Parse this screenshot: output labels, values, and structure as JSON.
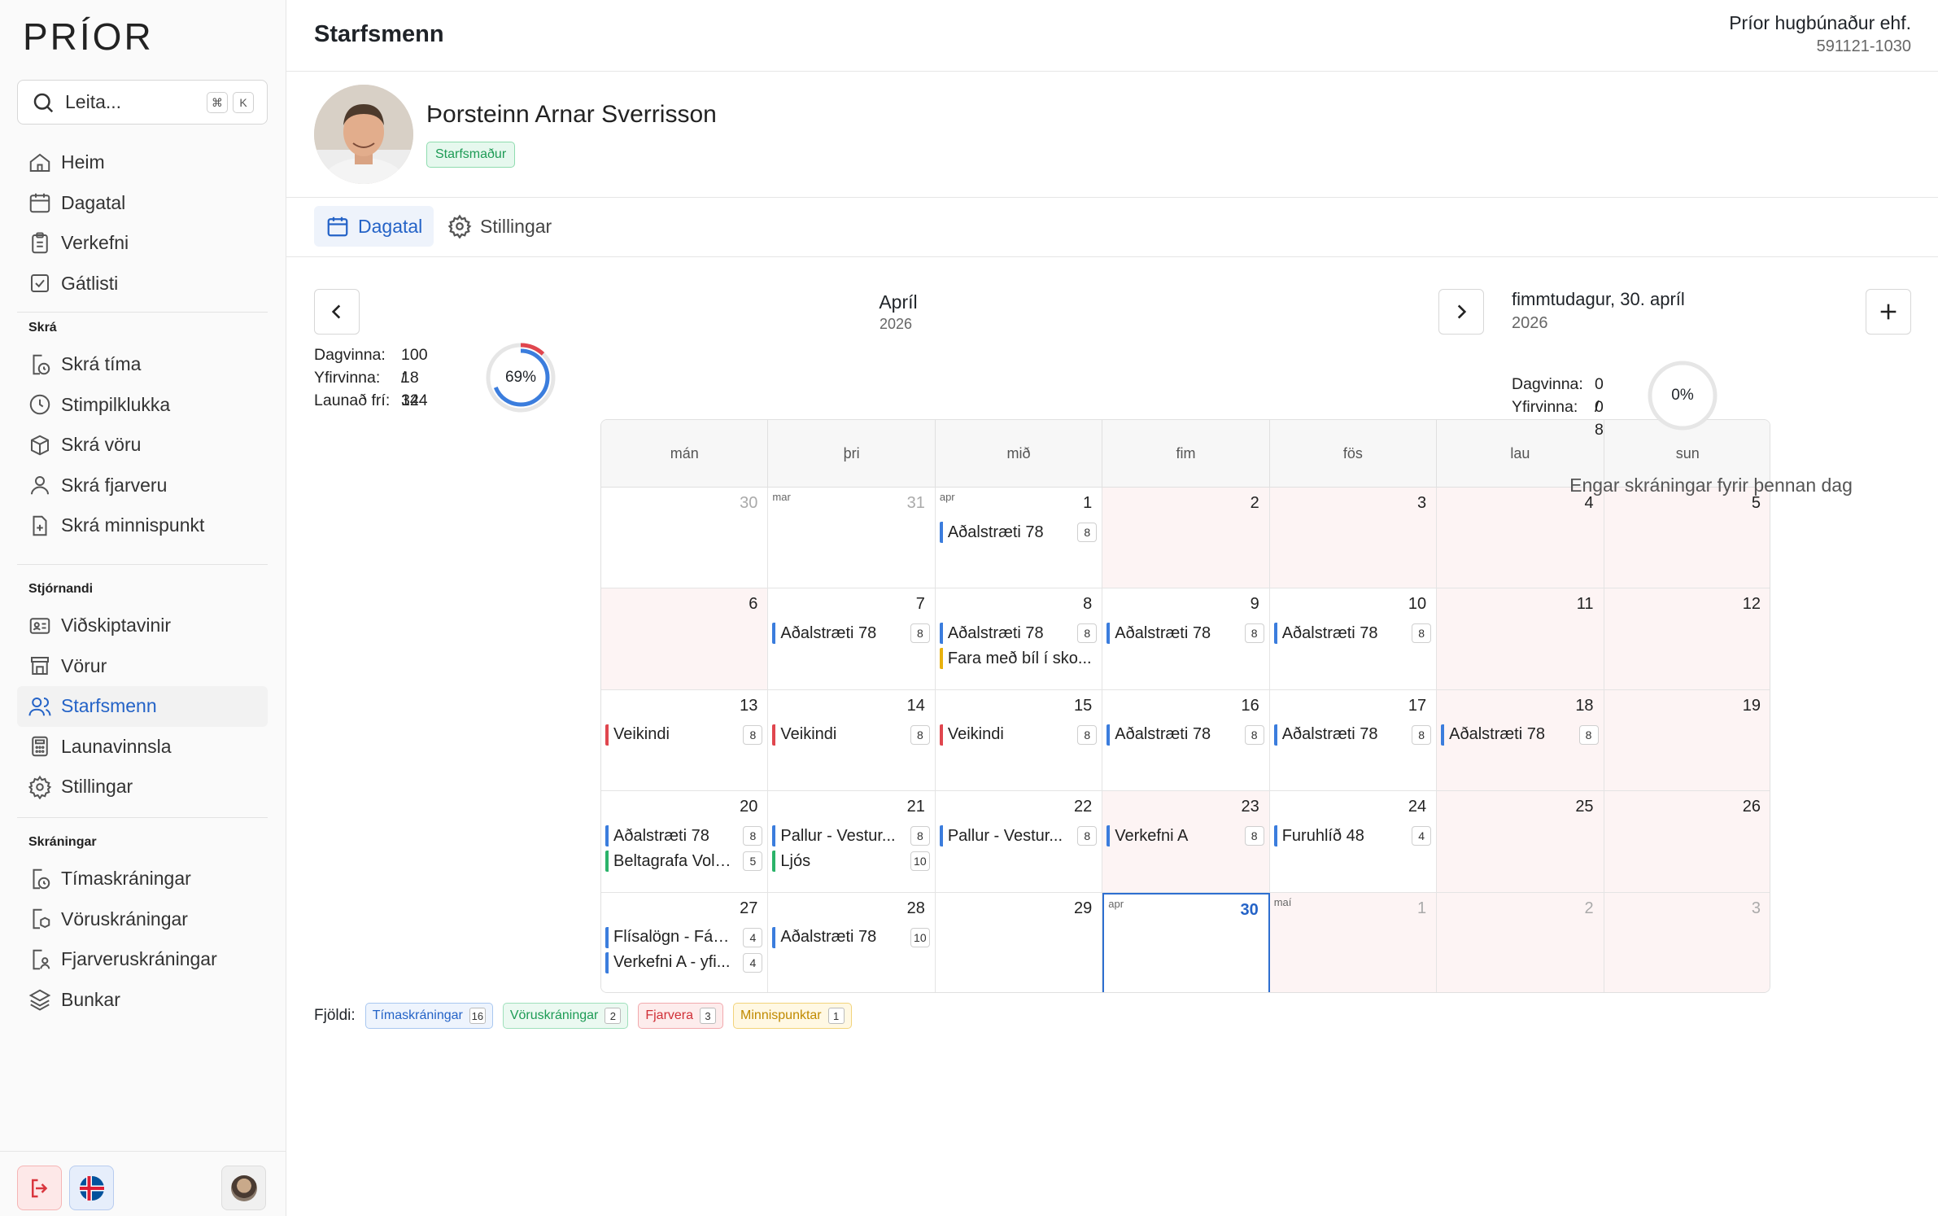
{
  "sidebar": {
    "logo": "PRÍOR",
    "search": {
      "label": "Leita...",
      "k1": "⌘",
      "k2": "K"
    },
    "main_items": [
      {
        "label": "Heim",
        "icon": "home-icon"
      },
      {
        "label": "Dagatal",
        "icon": "calendar-icon"
      },
      {
        "label": "Verkefni",
        "icon": "clipboard-icon"
      },
      {
        "label": "Gátlisti",
        "icon": "checkbox-icon"
      }
    ],
    "skra_title": "Skrá",
    "skra_items": [
      {
        "label": "Skrá tíma",
        "icon": "timer-doc-icon"
      },
      {
        "label": "Stimpilklukka",
        "icon": "clock-icon"
      },
      {
        "label": "Skrá vöru",
        "icon": "package-icon"
      },
      {
        "label": "Skrá fjarveru",
        "icon": "user-icon"
      },
      {
        "label": "Skrá minnispunkt",
        "icon": "note-plus-icon"
      }
    ],
    "admin_title": "Stjórnandi",
    "admin_items": [
      {
        "label": "Viðskiptavinir",
        "icon": "contact-card-icon"
      },
      {
        "label": "Vörur",
        "icon": "store-icon"
      },
      {
        "label": "Starfsmenn",
        "icon": "users-icon",
        "active": true
      },
      {
        "label": "Launavinnsla",
        "icon": "calculator-icon"
      },
      {
        "label": "Stillingar",
        "icon": "gear-icon"
      }
    ],
    "reg_title": "Skráningar",
    "reg_items": [
      {
        "label": "Tímaskráningar",
        "icon": "timer-doc-icon"
      },
      {
        "label": "Vöruskráningar",
        "icon": "package-doc-icon"
      },
      {
        "label": "Fjarveruskráningar",
        "icon": "user-doc-icon"
      },
      {
        "label": "Bunkar",
        "icon": "layers-icon"
      }
    ]
  },
  "header": {
    "title": "Starfsmenn",
    "company": "Príor hugbúnaður ehf.",
    "kennitala": "591121-1030"
  },
  "employee": {
    "name": "Þorsteinn Arnar Sverrisson",
    "role": "Starfsmaður"
  },
  "tabs": [
    {
      "label": "Dagatal",
      "icon": "calendar-icon"
    },
    {
      "label": "Stillingar",
      "icon": "gear-icon"
    }
  ],
  "calendar": {
    "month": "Apríl",
    "year": "2026",
    "stats": {
      "dagvinna_label": "Dagvinna:",
      "dagvinna": "100 / 144",
      "yfirvinna_label": "Yfirvinna:",
      "yfirvinna": "18",
      "launad_label": "Launað frí:",
      "launad": "32",
      "percent": "69%",
      "fraction": 0.69
    },
    "weekdays": [
      "mán",
      "þri",
      "mið",
      "fim",
      "fös",
      "lau",
      "sun"
    ],
    "weeks": [
      [
        {
          "d": "30",
          "dim": true
        },
        {
          "d": "31",
          "dim": true,
          "m": "mar"
        },
        {
          "d": "1",
          "m": "apr",
          "ev": [
            {
              "t": "Aðalstræti 78",
              "n": "8",
              "c": "blue"
            }
          ]
        },
        {
          "d": "2",
          "we": true
        },
        {
          "d": "3",
          "we": true
        },
        {
          "d": "4",
          "we": true
        },
        {
          "d": "5",
          "we": true
        }
      ],
      [
        {
          "d": "6",
          "we": true
        },
        {
          "d": "7",
          "ev": [
            {
              "t": "Aðalstræti 78",
              "n": "8",
              "c": "blue"
            }
          ]
        },
        {
          "d": "8",
          "ev": [
            {
              "t": "Aðalstræti 78",
              "n": "8",
              "c": "blue"
            },
            {
              "t": "Fara með bíl í sko...",
              "n": "",
              "c": "yellow"
            }
          ]
        },
        {
          "d": "9",
          "ev": [
            {
              "t": "Aðalstræti 78",
              "n": "8",
              "c": "blue"
            }
          ]
        },
        {
          "d": "10",
          "ev": [
            {
              "t": "Aðalstræti 78",
              "n": "8",
              "c": "blue"
            }
          ]
        },
        {
          "d": "11",
          "we": true
        },
        {
          "d": "12",
          "we": true
        }
      ],
      [
        {
          "d": "13",
          "ev": [
            {
              "t": "Veikindi",
              "n": "8",
              "c": "red"
            }
          ]
        },
        {
          "d": "14",
          "ev": [
            {
              "t": "Veikindi",
              "n": "8",
              "c": "red"
            }
          ]
        },
        {
          "d": "15",
          "ev": [
            {
              "t": "Veikindi",
              "n": "8",
              "c": "red"
            }
          ]
        },
        {
          "d": "16",
          "ev": [
            {
              "t": "Aðalstræti 78",
              "n": "8",
              "c": "blue"
            }
          ]
        },
        {
          "d": "17",
          "ev": [
            {
              "t": "Aðalstræti 78",
              "n": "8",
              "c": "blue"
            }
          ]
        },
        {
          "d": "18",
          "we": true,
          "ev": [
            {
              "t": "Aðalstræti 78",
              "n": "8",
              "c": "blue"
            }
          ]
        },
        {
          "d": "19",
          "we": true
        }
      ],
      [
        {
          "d": "20",
          "ev": [
            {
              "t": "Aðalstræti 78",
              "n": "8",
              "c": "blue"
            },
            {
              "t": "Beltagrafa Volv...",
              "n": "5",
              "c": "green"
            }
          ]
        },
        {
          "d": "21",
          "ev": [
            {
              "t": "Pallur - Vestur...",
              "n": "8",
              "c": "blue"
            },
            {
              "t": "Ljós",
              "n": "10",
              "c": "green"
            }
          ]
        },
        {
          "d": "22",
          "ev": [
            {
              "t": "Pallur - Vestur...",
              "n": "8",
              "c": "blue"
            }
          ]
        },
        {
          "d": "23",
          "we": true,
          "ev": [
            {
              "t": "Verkefni A",
              "n": "8",
              "c": "blue"
            }
          ]
        },
        {
          "d": "24",
          "ev": [
            {
              "t": "Furuhlíð 48",
              "n": "4",
              "c": "blue"
            }
          ]
        },
        {
          "d": "25",
          "we": true
        },
        {
          "d": "26",
          "we": true
        }
      ],
      [
        {
          "d": "27",
          "ev": [
            {
              "t": "Flísalögn - Fálk...",
              "n": "4",
              "c": "blue"
            },
            {
              "t": "Verkefni A - yfi...",
              "n": "4",
              "c": "blue"
            }
          ]
        },
        {
          "d": "28",
          "ev": [
            {
              "t": "Aðalstræti 78",
              "n": "10",
              "c": "blue"
            }
          ]
        },
        {
          "d": "29"
        },
        {
          "d": "30",
          "m": "apr",
          "today": true
        },
        {
          "d": "1",
          "m": "maí",
          "dim": true,
          "we": true
        },
        {
          "d": "2",
          "dim": true,
          "we": true
        },
        {
          "d": "3",
          "dim": true,
          "we": true
        }
      ]
    ]
  },
  "legend": {
    "label": "Fjöldi:",
    "items": [
      {
        "t": "Tímaskráningar",
        "n": "16",
        "c": "blue"
      },
      {
        "t": "Vöruskráningar",
        "n": "2",
        "c": "green"
      },
      {
        "t": "Fjarvera",
        "n": "3",
        "c": "red"
      },
      {
        "t": "Minnispunktar",
        "n": "1",
        "c": "yellow"
      }
    ]
  },
  "day_panel": {
    "date": "fimmtudagur, 30. apríl",
    "year": "2026",
    "dagvinna_label": "Dagvinna:",
    "dagvinna": "0 / 8",
    "yfirvinna_label": "Yfirvinna:",
    "yfirvinna": "0",
    "percent": "0%",
    "empty": "Engar skráningar fyrir þennan dag"
  },
  "colors": {
    "blue": "#3b7ddd",
    "green": "#2bb36a",
    "red": "#e0464e",
    "yellow": "#e8b10e",
    "accent": "#2463c7"
  }
}
